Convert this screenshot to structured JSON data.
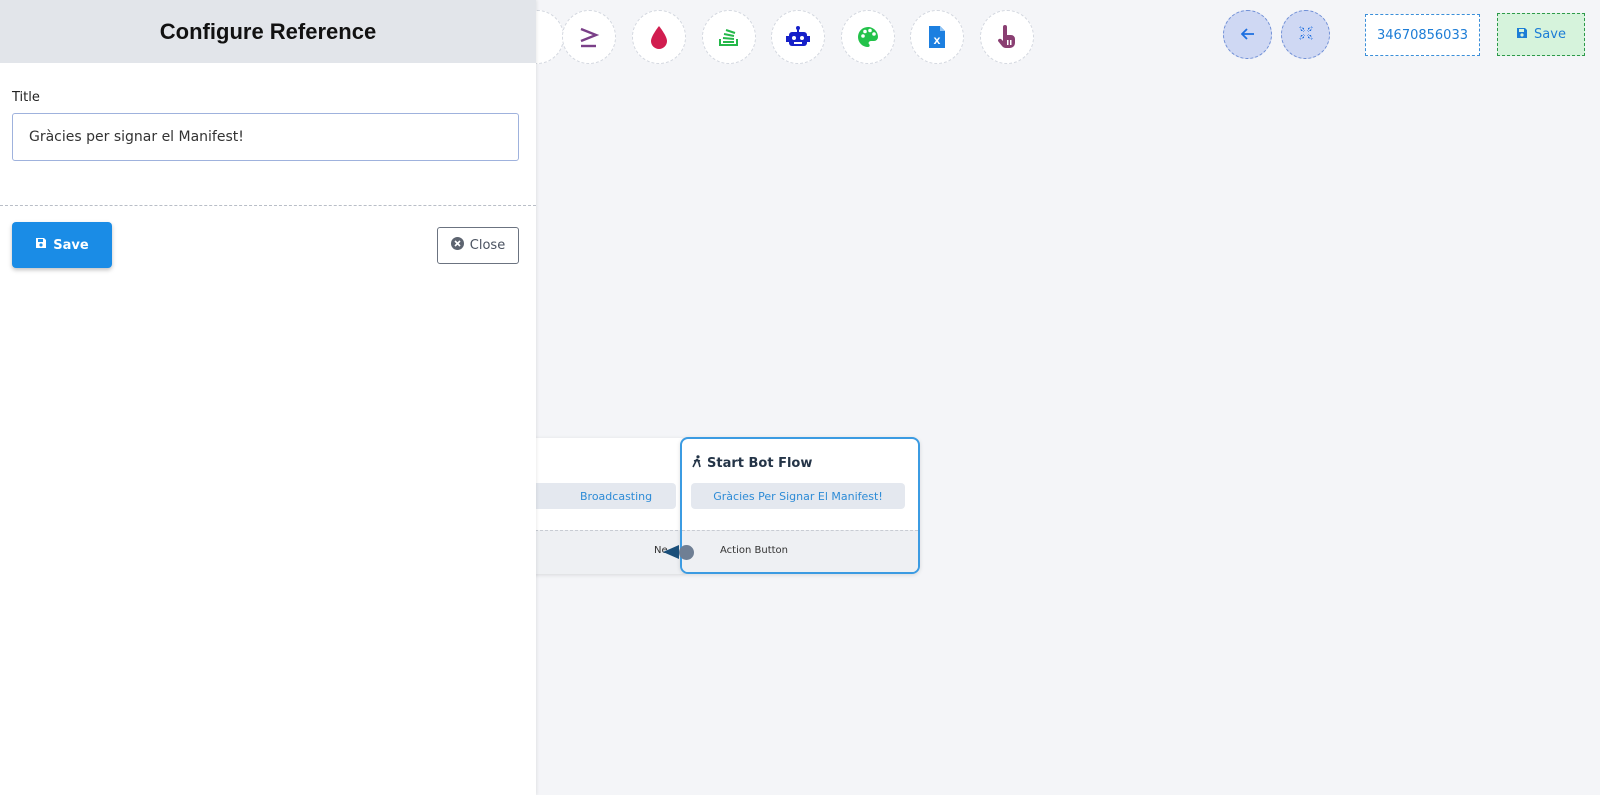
{
  "panel": {
    "title": "Configure Reference",
    "title_field_label": "Title",
    "title_field_value": "Gràcies per signar el Manifest!",
    "save_label": "Save",
    "close_label": "Close"
  },
  "toolbar": {
    "icons": [
      "condition-icon",
      "greater-equal-icon",
      "drop-icon",
      "stack-icon",
      "bot-icon",
      "palette-icon",
      "excel-file-icon",
      "pointer-hand-icon"
    ],
    "back_icon": "arrow-left-icon",
    "fit_icon": "compress-icon",
    "phone_number": "34670856033",
    "save_label": "Save"
  },
  "flow": {
    "left_node": {
      "pill_text": "Broadcasting",
      "footer_text": "Ne"
    },
    "right_node": {
      "title": "Start Bot Flow",
      "pill_text": "Gràcies Per Signar El Manifest!",
      "footer_text": "Action Button"
    }
  },
  "colors": {
    "accent_blue": "#1a8ce6",
    "node_border": "#3b9be2",
    "save_green_bg": "#d6f3dc"
  }
}
